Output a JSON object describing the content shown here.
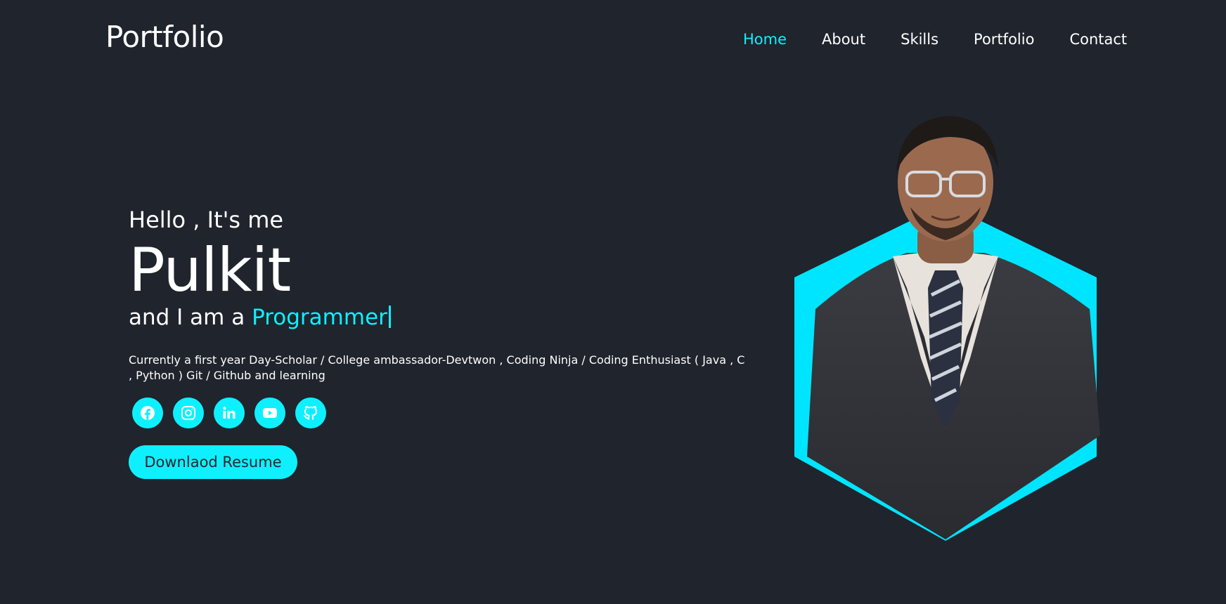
{
  "header": {
    "logo": "Portfolio",
    "nav": [
      {
        "label": "Home",
        "active": true
      },
      {
        "label": "About",
        "active": false
      },
      {
        "label": "Skills",
        "active": false
      },
      {
        "label": "Portfolio",
        "active": false
      },
      {
        "label": "Contact",
        "active": false
      }
    ]
  },
  "hero": {
    "greeting": "Hello , It's me",
    "name": "Pulkit",
    "role_prefix": "and I am a",
    "role_highlight": "Programmer",
    "description": "Currently a first year Day-Scholar / College ambassador-Devtwon , Coding Ninja / Coding Enthusiast ( Java , C , Python ) Git / Github and learning",
    "socials": [
      {
        "icon": "facebook-icon"
      },
      {
        "icon": "instagram-icon"
      },
      {
        "icon": "linkedin-icon"
      },
      {
        "icon": "youtube-icon"
      },
      {
        "icon": "github-icon"
      }
    ],
    "button_label": "Downlaod Resume"
  },
  "colors": {
    "background": "#1f242d",
    "accent": "#0ef0ff",
    "text": "#ffffff"
  }
}
